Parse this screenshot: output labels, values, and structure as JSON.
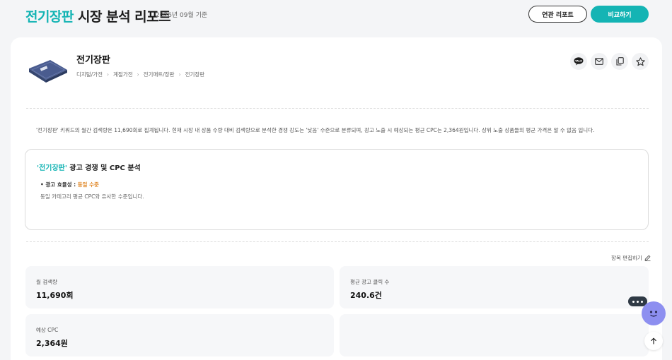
{
  "header": {
    "title_keyword": "전기장판",
    "title_rest": " 시장 분석 리포트",
    "base_date": "2026년 09월 기준",
    "related_report_label": "연관 리포트",
    "compare_label": "비교하기"
  },
  "product": {
    "name": "전기장판",
    "breadcrumb": [
      "디지털/가전",
      "계절가전",
      "전기매트/장판",
      "전기장판"
    ]
  },
  "actions": [
    "talk-icon",
    "mail-icon",
    "copy-icon",
    "star-icon"
  ],
  "summary": "'전기장판' 키워드의 월간 검색량은 11,690회로 집계됩니다. 현재 시장 내 상품 수량 대비 검색량으로 분석한 경쟁 강도는 '낮음' 수준으로 분류되며, 광고 노출 시 예상되는 평균 CPC는 2,364원입니다. 상위 노출 상품들의 평균 가격은 알 수 없음 입니다.",
  "ad_analysis": {
    "keyword": "'전기장판'",
    "title_rest": " 광고 경쟁 및 CPC 분석",
    "efficiency_label": "• 광고 효율성 : ",
    "efficiency_value": "동일 수준",
    "description": "동일 카테고리 평균 CPC와 유사한 수준입니다."
  },
  "edit_label": "항목 편집하기",
  "stats": [
    {
      "label": "월 검색량",
      "value": "11,690회"
    },
    {
      "label": "평균 광고 클릭 수",
      "value": "240.6건"
    },
    {
      "label": "예상 CPC",
      "value": "2,364원"
    }
  ],
  "colors": {
    "accent": "#14b4b4",
    "efficiency": "#e08a2b",
    "chatbot": "#8d8ff0"
  }
}
